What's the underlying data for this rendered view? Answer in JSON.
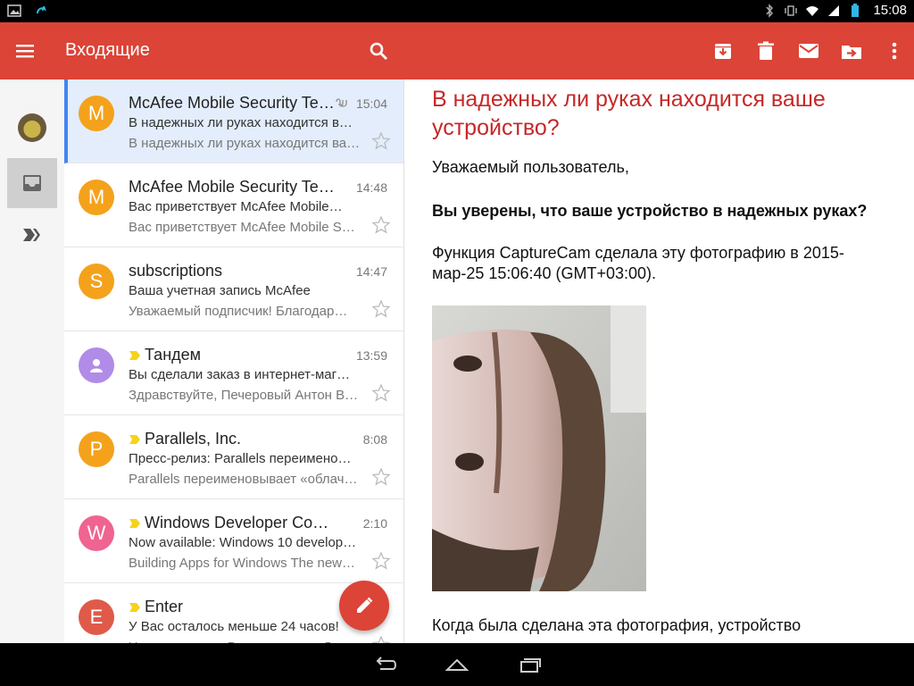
{
  "status_bar": {
    "time": "15:08"
  },
  "app_bar": {
    "title": "Входящие",
    "icons": [
      "menu-icon",
      "search-icon",
      "archive-icon",
      "delete-icon",
      "mark-unread-icon",
      "move-to-icon",
      "more-vert-icon"
    ]
  },
  "messages": [
    {
      "initial": "M",
      "avatar_color": "#f4a21c",
      "sender": "McAfee Mobile Security Te…",
      "time": "15:04",
      "subject": "В надежных ли руках находится в…",
      "snippet": "В надежных ли руках находится ва…",
      "attachment": true,
      "important": false,
      "selected": true,
      "person_icon": false
    },
    {
      "initial": "M",
      "avatar_color": "#f4a21c",
      "sender": "McAfee Mobile Security Team",
      "time": "14:48",
      "subject": "Вас приветствует McAfee Mobile…",
      "snippet": "Вас приветствует McAfee Mobile S…",
      "attachment": false,
      "important": false,
      "selected": false,
      "person_icon": false
    },
    {
      "initial": "S",
      "avatar_color": "#f4a21c",
      "sender": "subscriptions",
      "time": "14:47",
      "subject": "Ваша учетная запись McAfee",
      "snippet": "Уважаемый подписчик! Благодар…",
      "attachment": false,
      "important": false,
      "selected": false,
      "person_icon": false
    },
    {
      "initial": "",
      "avatar_color": "#b08be8",
      "sender": "Тандем",
      "time": "13:59",
      "subject": "Вы сделали заказ в интернет-маг…",
      "snippet": "Здравствуйте, Печеровый Антон В…",
      "attachment": false,
      "important": true,
      "selected": false,
      "person_icon": true
    },
    {
      "initial": "P",
      "avatar_color": "#f4a21c",
      "sender": "Parallels, Inc.",
      "time": "8:08",
      "subject": "Пресс-релиз: Parallels переимено…",
      "snippet": "Parallels переименовывает «облач…",
      "attachment": false,
      "important": true,
      "selected": false,
      "person_icon": false
    },
    {
      "initial": "W",
      "avatar_color": "#ef6491",
      "sender": "Windows Developer Commu…",
      "time": "2:10",
      "subject": "Now available: Windows 10 develop…",
      "snippet": "Building Apps for Windows The new…",
      "attachment": false,
      "important": true,
      "selected": false,
      "person_icon": false
    },
    {
      "initial": "E",
      "avatar_color": "#e05a4a",
      "sender": "Enter",
      "time": "",
      "subject": "У Вас осталось меньше 24 часов!",
      "snippet": "Уведомление о Вашем заказе. Для…",
      "attachment": false,
      "important": true,
      "selected": false,
      "person_icon": false
    }
  ],
  "reading_pane": {
    "title": "В надежных ли руках находится ваше устройство?",
    "greeting": "Уважаемый пользователь,",
    "question": "Вы уверены, что ваше устройство в надежных руках?",
    "paragraph": "Функция CaptureCam сделала эту фотографию в 2015-мар-25 15:06:40 (GMT+03:00).",
    "last_line": "Когда была сделана эта фотография, устройство"
  },
  "colors": {
    "accent": "#db4437",
    "selected_row": "#e3edfc",
    "selected_bar": "#4285f4",
    "title_red": "#c62828"
  }
}
